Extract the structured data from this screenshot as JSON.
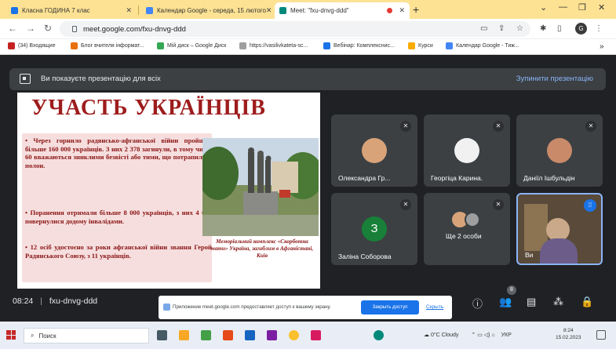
{
  "browser": {
    "tabs": [
      {
        "title": "Класна ГОДИНА 7 клас",
        "favicon_color": "#1a73e8"
      },
      {
        "title": "Календар Google - середа, 15 лютого",
        "favicon_color": "#4285f4"
      },
      {
        "title": "Meet: \"fxu-dnvg-ddd\"",
        "favicon_color": "#00897b"
      }
    ],
    "recording_dot_color": "#e53935",
    "url": "meet.google.com/fxu-dnvg-ddd",
    "avatar_letter": "G",
    "bookmarks": [
      {
        "label": "(34) Входящие",
        "color": "#c5221f"
      },
      {
        "label": "Блог вчителя інформат...",
        "color": "#e8710a"
      },
      {
        "label": "Мій диск – Google Диск",
        "color": "#34a853"
      },
      {
        "label": "https://vasilivkateta-sc...",
        "color": "#9e9e9e"
      },
      {
        "label": "Вебінар: Комплекснис...",
        "color": "#1a73e8"
      },
      {
        "label": "Курси",
        "color": "#f9ab00"
      },
      {
        "label": "Календар Google - Тиж...",
        "color": "#4285f4"
      }
    ]
  },
  "meet": {
    "banner": {
      "text": "Ви показуєте презентацію для всіх",
      "stop_label": "Зупинити презентацію"
    },
    "slide": {
      "title": "УЧАСТЬ УКРАЇНЦІВ",
      "paragraphs": [
        "• Через горнило радянсько-афганської війни пройшло більше 160 000 українців. З них 2 378 загинули, в тому числі 60 вважаються зниклими безвісті або тими, що потрапили в полон.",
        "• Поранення отримали більше 8 000 українців, з них 4 687 повернулися додому інвалідами.",
        "• 12 осіб удостоєно за роки афганської війни звання Герой Радянського Союзу, з 11 українців."
      ],
      "caption": "Меморіальний комплекс «Скорботна мати» Україна, загиблим в Афганістані, Київ"
    },
    "participants": [
      {
        "name": "Олександра Гр...",
        "avatar_color": "#d9a37a"
      },
      {
        "name": "Георгіца Карина.",
        "avatar_color": "#f1f1f1"
      },
      {
        "name": "Даніїл Ішбульдін",
        "avatar_color": "#c98a6a"
      },
      {
        "name": "Заліна Соборова",
        "avatar_letter": "З",
        "avatar_color": "#188038"
      },
      {
        "name": "Ще 2 особи",
        "avatar_color": "#9e9e9e"
      },
      {
        "name": "Ви",
        "avatar_color": "#7a6a5a"
      }
    ],
    "time": "08:24",
    "meeting_code": "fxu-dnvg-ddd",
    "people_badge": "8",
    "toast": {
      "text": "Приложение meet.google.com предоставляет доступ к вашему экрану.",
      "button_label": "Закрыть доступ",
      "hide_label": "Скрыть"
    }
  },
  "taskbar": {
    "search_placeholder": "Поиск",
    "weather": "0°C Cloudy",
    "lang": "УКР",
    "clock_time": "8:24",
    "clock_date": "15.02.2023"
  }
}
